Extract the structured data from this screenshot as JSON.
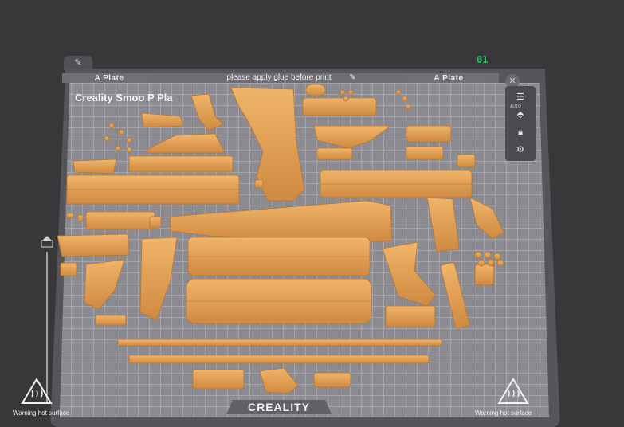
{
  "plate": {
    "id": "01",
    "label_left": "A Plate",
    "label_right": "A Plate",
    "glue_note": "please apply glue before print",
    "title": "Creality Smoo  P  Pla",
    "logo": "CREALITY",
    "warning_left": "Warning hot surface",
    "warning_right": "Warning hot surface"
  },
  "toolbar": {
    "auto_label": "AUTO"
  },
  "colors": {
    "background": "#38383b",
    "bed": "#8b8b91",
    "grid": "#a4a4aa",
    "part_fill": "#e8a55a",
    "part_shade": "#c9853b",
    "plate_id": "#21c05a"
  },
  "icons": {
    "edit": "pencil-icon",
    "glue_edit": "pencil-icon",
    "close": "close-icon",
    "list": "list-icon",
    "auto_orient": "auto-orient-icon",
    "lock": "lock-icon",
    "settings": "gear-icon",
    "warning": "hot-surface-warning-icon"
  }
}
